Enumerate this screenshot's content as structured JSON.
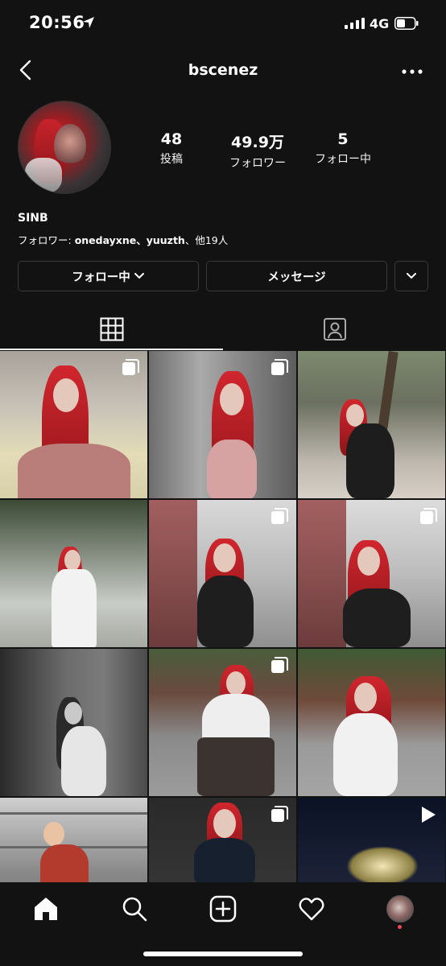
{
  "status_bar": {
    "time": "20:56",
    "network": "4G"
  },
  "header": {
    "username": "bscenez"
  },
  "profile": {
    "stats": [
      {
        "value": "48",
        "label": "投稿"
      },
      {
        "value": "49.9万",
        "label": "フォロワー"
      },
      {
        "value": "5",
        "label": "フォロー中"
      }
    ],
    "display_name": "SINB",
    "followed_by_prefix": "フォロワー: ",
    "followed_by_names": "onedayxne、yuuzth",
    "followed_by_suffix": "、他19人"
  },
  "actions": {
    "following_label": "フォロー中",
    "message_label": "メッセージ"
  },
  "tabs": [
    {
      "icon": "grid-icon",
      "active": true
    },
    {
      "icon": "tagged-icon",
      "active": false
    }
  ],
  "grid": [
    {
      "badge": "carousel-icon"
    },
    {
      "badge": "carousel-icon"
    },
    {
      "badge": ""
    },
    {
      "badge": ""
    },
    {
      "badge": "carousel-icon"
    },
    {
      "badge": "carousel-icon"
    },
    {
      "badge": ""
    },
    {
      "badge": "carousel-icon"
    },
    {
      "badge": ""
    },
    {
      "badge": ""
    },
    {
      "badge": "carousel-icon"
    },
    {
      "badge": "video-icon"
    }
  ],
  "nav": [
    "home-icon",
    "search-icon",
    "create-icon",
    "activity-icon",
    "profile-avatar"
  ],
  "colors": {
    "background": "#121212",
    "text": "#ffffff",
    "border": "#3a3a3a",
    "notification_dot": "#ed4956"
  }
}
